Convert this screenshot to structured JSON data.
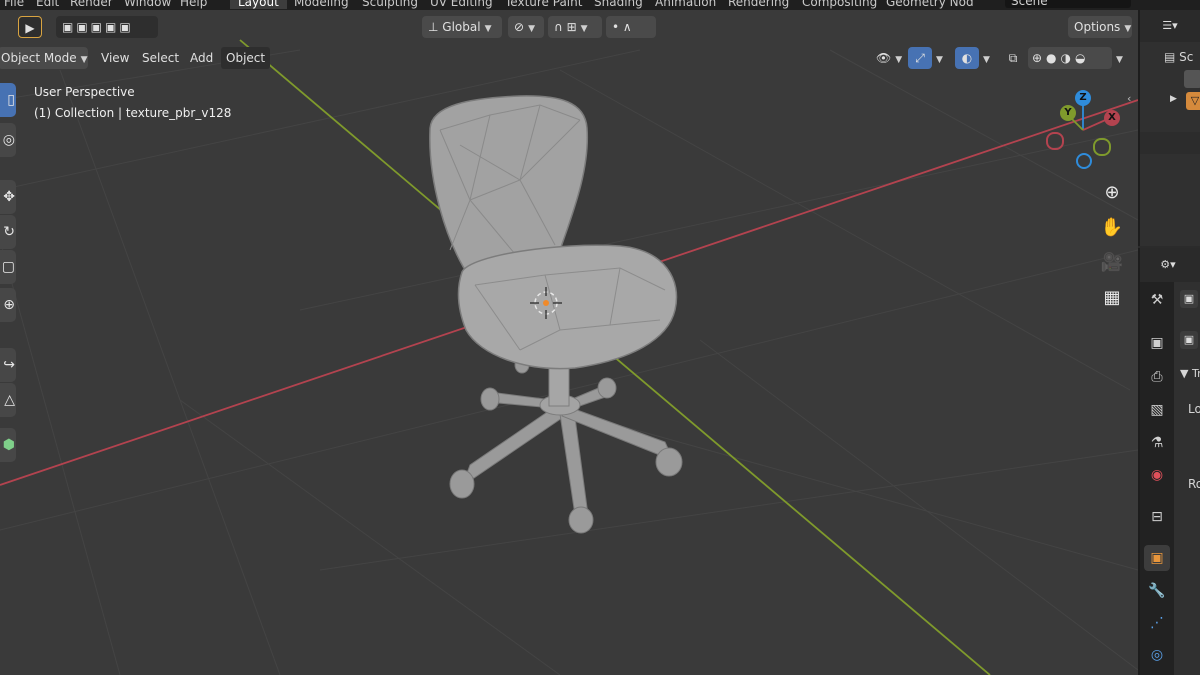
{
  "topbar": {
    "menus": [
      "File",
      "Edit",
      "Render",
      "Window",
      "Help"
    ],
    "workspaces": [
      "Layout",
      "Modeling",
      "Sculpting",
      "UV Editing",
      "Texture Paint",
      "Shading",
      "Animation",
      "Rendering",
      "Compositing",
      "Geometry Nod"
    ],
    "active_workspace": "Layout",
    "scene_field": "Scene"
  },
  "viewport_header": {
    "transform_orientation": "Global",
    "options_label": "Options",
    "mode": "Object Mode",
    "menus": [
      "View",
      "Select",
      "Add",
      "Object"
    ]
  },
  "overlay": {
    "perspective": "User Perspective",
    "collection_info": "(1) Collection | texture_pbr_v128"
  },
  "gizmo": {
    "x": "X",
    "y": "Y",
    "z": "Z"
  },
  "outliner": {
    "scene_label": "Sc"
  },
  "properties": {
    "panel_label": "Tr",
    "location_label": "Lo",
    "rotation_label": "Ro"
  },
  "colors": {
    "x_axis": "#b3434f",
    "y_axis": "#7f9a2c",
    "z_axis": "#2f8cdb",
    "accent": "#4772b3",
    "viewport_bg": "#3a3a3a",
    "chair": "#9c9c9c"
  },
  "icons": {
    "select_tool": "cursor-arrow-icon",
    "zoom": "zoom-in-icon",
    "pan": "hand-icon",
    "camera": "camera-icon",
    "ortho": "grid-icon"
  }
}
